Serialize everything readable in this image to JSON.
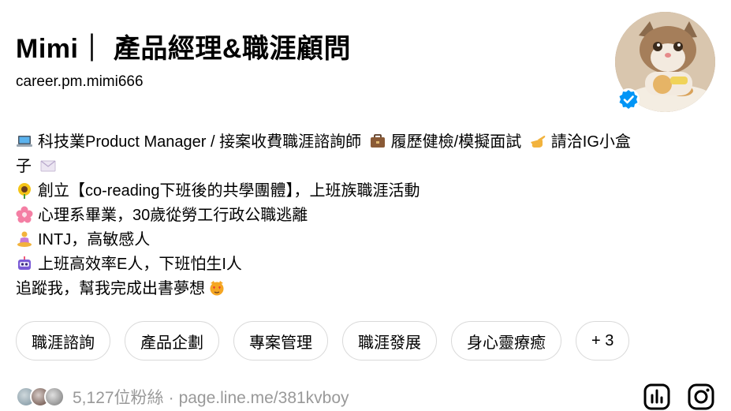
{
  "profile": {
    "name": "Mimi｜ 產品經理&職涯顧問",
    "handle": "career.pm.mimi666"
  },
  "bio": {
    "line1": "科技業Product Manager / 接案收費職涯諮詢師",
    "line1b": "履歷健檢/模擬面試",
    "line1c": "請洽IG小盒",
    "line1d": "子",
    "line2": "創立【co-reading下班後的共學團體】，上班族職涯活動",
    "line3": "心理系畢業，30歲從勞工行政公職逃離",
    "line4": "INTJ，高敏感人",
    "line5": "上班高效率E人，下班怕生I人",
    "line6": "追蹤我，幫我完成出書夢想"
  },
  "icons": {
    "laptop": "laptop-icon",
    "briefcase": "briefcase-icon",
    "pointing": "pointing-hand-icon",
    "envelope": "envelope-icon",
    "sunflower": "sunflower-icon",
    "blossom": "cherry-blossom-icon",
    "meditation": "meditation-icon",
    "robot": "robot-icon",
    "cat": "heart-eyes-cat-icon"
  },
  "tags": [
    "職涯諮詢",
    "產品企劃",
    "專案管理",
    "職涯發展",
    "身心靈療癒",
    "+ 3"
  ],
  "footer": {
    "followers": "5,127位粉絲",
    "separator": "·",
    "link": "page.line.me/381kvboy"
  },
  "colors": {
    "verified": "#0095f6",
    "muted": "#999999",
    "border": "#d9d9d9"
  }
}
